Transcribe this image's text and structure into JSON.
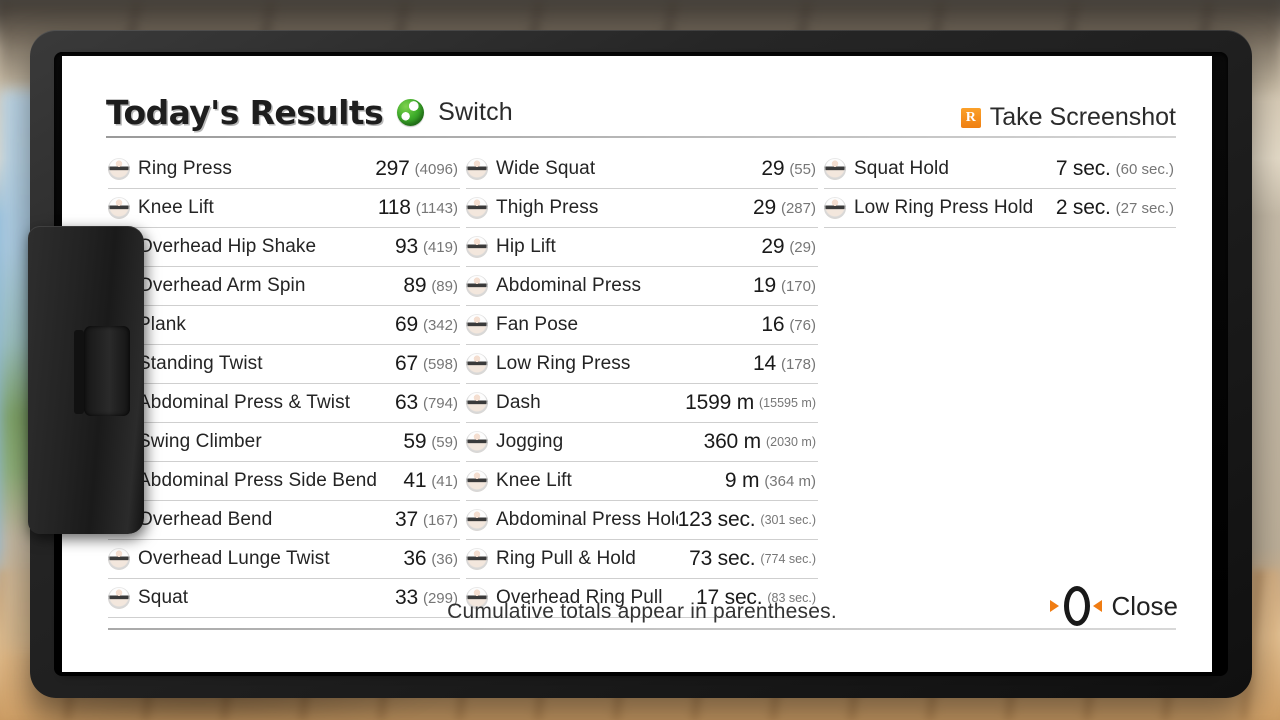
{
  "background": {
    "scene": "blurred indoor room with window and wood floor"
  },
  "device": {
    "name": "handheld-console-tablet",
    "joycon_side": "left"
  },
  "header": {
    "title": "Today's Results",
    "profile_icon": "green-ball-icon",
    "profile_name": "Switch",
    "screenshot_button": {
      "badge": "R",
      "label": "Take Screenshot"
    }
  },
  "colors": {
    "accent_orange": "#f07c12",
    "badge_orange": "#ef7f12",
    "profile_green": "#3fae2b",
    "text_primary": "#1a1a1a",
    "text_secondary": "#767676",
    "rule": "#cfcfcf"
  },
  "columns": [
    {
      "id": "column-1",
      "rows": [
        {
          "icon": "exercise-thumb-ring-press",
          "name": "Ring Press",
          "value": "297",
          "total": "(4096)"
        },
        {
          "icon": "exercise-thumb-knee-lift",
          "name": "Knee Lift",
          "value": "118",
          "total": "(1143)"
        },
        {
          "icon": "exercise-thumb-overhead-hip-shake",
          "name": "Overhead Hip Shake",
          "value": "93",
          "total": "(419)"
        },
        {
          "icon": "exercise-thumb-overhead-arm-spin",
          "name": "Overhead Arm Spin",
          "value": "89",
          "total": "(89)"
        },
        {
          "icon": "exercise-thumb-plank",
          "name": "Plank",
          "value": "69",
          "total": "(342)"
        },
        {
          "icon": "exercise-thumb-standing-twist",
          "name": "Standing Twist",
          "value": "67",
          "total": "(598)"
        },
        {
          "icon": "exercise-thumb-abdominal-press-twist",
          "name": "Abdominal Press & Twist",
          "value": "63",
          "total": "(794)"
        },
        {
          "icon": "exercise-thumb-swing-climber",
          "name": "Swing Climber",
          "value": "59",
          "total": "(59)"
        },
        {
          "icon": "exercise-thumb-abdominal-press-side-bend",
          "name": "Abdominal Press Side Bend",
          "value": "41",
          "total": "(41)"
        },
        {
          "icon": "exercise-thumb-overhead-bend",
          "name": "Overhead Bend",
          "value": "37",
          "total": "(167)"
        },
        {
          "icon": "exercise-thumb-overhead-lunge-twist",
          "name": "Overhead Lunge Twist",
          "value": "36",
          "total": "(36)"
        },
        {
          "icon": "exercise-thumb-squat",
          "name": "Squat",
          "value": "33",
          "total": "(299)"
        }
      ]
    },
    {
      "id": "column-2",
      "rows": [
        {
          "icon": "exercise-thumb-wide-squat",
          "name": "Wide Squat",
          "value": "29",
          "total": "(55)"
        },
        {
          "icon": "exercise-thumb-thigh-press",
          "name": "Thigh Press",
          "value": "29",
          "total": "(287)"
        },
        {
          "icon": "exercise-thumb-hip-lift",
          "name": "Hip Lift",
          "value": "29",
          "total": "(29)"
        },
        {
          "icon": "exercise-thumb-abdominal-press",
          "name": "Abdominal Press",
          "value": "19",
          "total": "(170)"
        },
        {
          "icon": "exercise-thumb-fan-pose",
          "name": "Fan Pose",
          "value": "16",
          "total": "(76)"
        },
        {
          "icon": "exercise-thumb-low-ring-press",
          "name": "Low Ring Press",
          "value": "14",
          "total": "(178)"
        },
        {
          "icon": "exercise-thumb-dash",
          "name": "Dash",
          "value": "1599 m",
          "total": "(15595 m)",
          "small_total": true
        },
        {
          "icon": "exercise-thumb-jogging",
          "name": "Jogging",
          "value": "360 m",
          "total": "(2030 m)",
          "small_total": true
        },
        {
          "icon": "exercise-thumb-knee-lift-distance",
          "name": "Knee Lift",
          "value": "9 m",
          "total": "(364 m)"
        },
        {
          "icon": "exercise-thumb-abdominal-press-hold",
          "name": "Abdominal Press Hold",
          "value": "123 sec.",
          "total": "(301 sec.)",
          "small_total": true
        },
        {
          "icon": "exercise-thumb-ring-pull-hold",
          "name": "Ring Pull & Hold",
          "value": "73 sec.",
          "total": "(774 sec.)",
          "small_total": true
        },
        {
          "icon": "exercise-thumb-overhead-ring-pull",
          "name": "Overhead Ring Pull",
          "value": "17 sec.",
          "total": "(83 sec.)",
          "small_total": true
        }
      ]
    },
    {
      "id": "column-3",
      "rows": [
        {
          "icon": "exercise-thumb-squat-hold",
          "name": "Squat Hold",
          "value": "7 sec.",
          "total": "(60 sec.)"
        },
        {
          "icon": "exercise-thumb-low-ring-press-hold",
          "name": "Low Ring Press Hold",
          "value": "2 sec.",
          "total": "(27 sec.)"
        }
      ]
    }
  ],
  "footer": {
    "note": "Cumulative totals appear in parentheses.",
    "close": {
      "icon": "ring-con-icon",
      "label": "Close"
    }
  }
}
